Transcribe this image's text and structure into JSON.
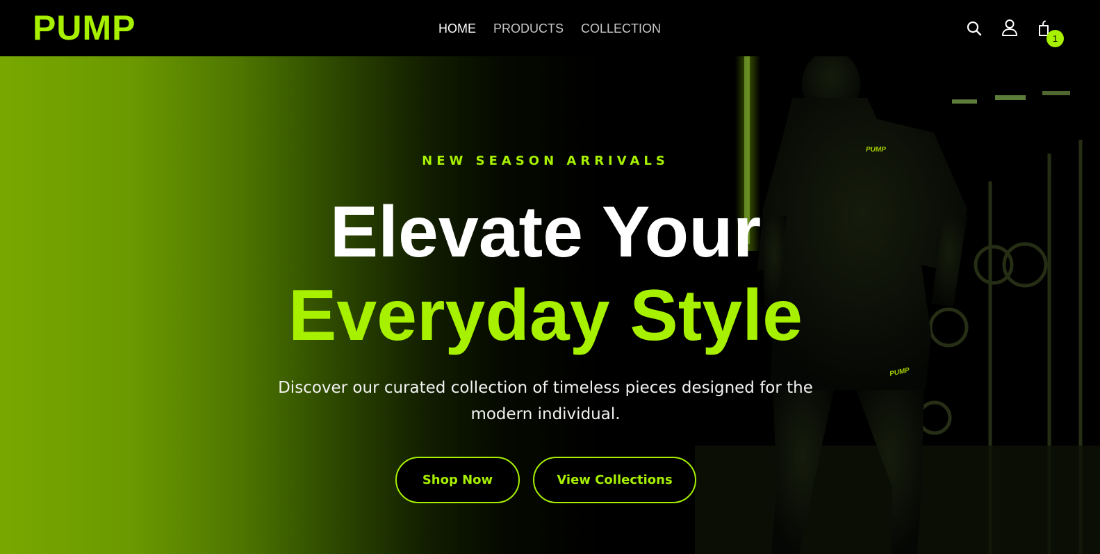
{
  "header": {
    "logo": "PUMP",
    "nav": [
      {
        "label": "HOME",
        "active": true
      },
      {
        "label": "PRODUCTS",
        "active": false
      },
      {
        "label": "COLLECTION",
        "active": false
      }
    ],
    "icons": {
      "search": "search-icon",
      "account": "user-icon",
      "cart": "cart-icon"
    },
    "cart_count": "1"
  },
  "hero": {
    "kicker": "NEW SEASON ARRIVALS",
    "headline_line1": "Elevate Your",
    "headline_line2": "Everyday Style",
    "subtext": "Discover our curated collection of timeless pieces designed for the modern individual.",
    "primary_button": "Shop Now",
    "secondary_button": "View Collections",
    "image_logo_text": "PUMP"
  },
  "colors": {
    "accent": "#a6f000",
    "background": "#000000",
    "text": "#ffffff"
  }
}
